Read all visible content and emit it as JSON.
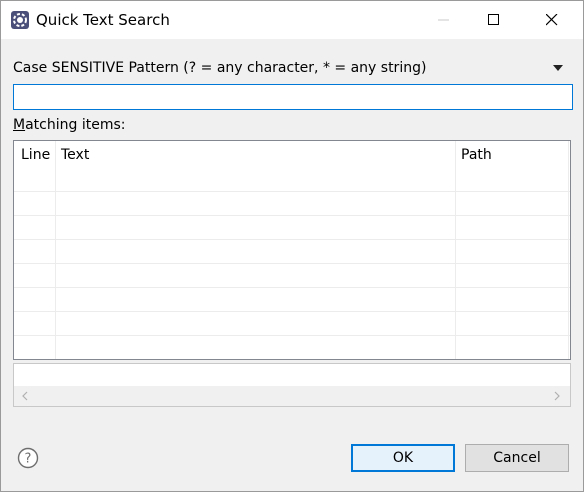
{
  "window": {
    "title": "Quick Text Search",
    "icon": "eclipse-gear-icon"
  },
  "titlebar_controls": [
    "minimize-icon",
    "maximize-icon",
    "close-icon"
  ],
  "search": {
    "label": "Case SENSITIVE Pattern (? = any character, * = any string)",
    "value": "",
    "history_icon": "dropdown-arrow-icon"
  },
  "results": {
    "label": "Matching items:",
    "mnemonic": "M",
    "columns": [
      "Line",
      "Text",
      "Path"
    ],
    "rows": []
  },
  "details": {
    "scroll_left_icon": "chevron-left-icon",
    "scroll_right_icon": "chevron-right-icon"
  },
  "footer": {
    "help_icon": "question-circle-icon",
    "ok_label": "OK",
    "cancel_label": "Cancel"
  },
  "colors": {
    "accent": "#0078d7",
    "dialog_bg": "#f0f0f0",
    "grid_line": "#ececec"
  }
}
